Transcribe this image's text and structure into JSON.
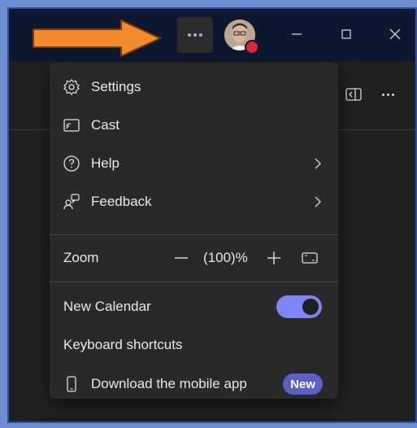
{
  "menu": {
    "items": [
      {
        "label": "Settings",
        "icon": "gear-icon"
      },
      {
        "label": "Cast",
        "icon": "cast-icon"
      },
      {
        "label": "Help",
        "icon": "help-icon",
        "submenu": true
      },
      {
        "label": "Feedback",
        "icon": "feedback-icon",
        "submenu": true
      }
    ],
    "zoom": {
      "label": "Zoom",
      "value": "(100)%"
    },
    "new_calendar": {
      "label": "New Calendar",
      "enabled": true
    },
    "keyboard_shortcuts": {
      "label": "Keyboard shortcuts"
    },
    "download": {
      "label": "Download the mobile app",
      "badge": "New",
      "icon": "phone-icon"
    }
  },
  "colors": {
    "accent": "#7f85f5",
    "badge": "#5b5fc7",
    "arrow": "#f28a2e",
    "titlebar": "#0d1830",
    "presence": "#e0263a"
  }
}
